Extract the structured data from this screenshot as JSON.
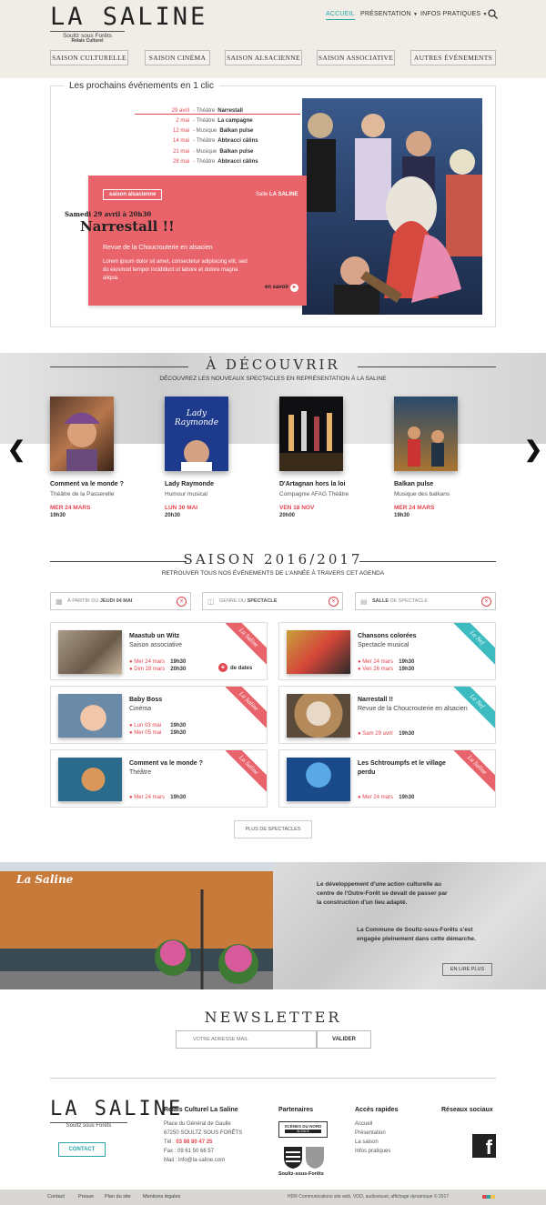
{
  "header": {
    "logo": "LA SALINE",
    "logo_sub": "Soultz sous Forêts",
    "logo_sub2": "Relais Culturel",
    "nav": [
      "ACCUEIL",
      "PRÉSENTATION",
      "INFOS PRATIQUES"
    ],
    "seasons": [
      "SAISON CULTURELLE",
      "SAISON CINÉMA",
      "SAISON ALSACIENNE",
      "SAISON ASSOCIATIVE",
      "AUTRES ÉVÉNEMENTS"
    ]
  },
  "featured": {
    "heading": "Les prochains événements en 1 clic",
    "events": [
      {
        "date": "29 avril",
        "cat": "Théâtre",
        "title": "Narrestall"
      },
      {
        "date": "2 mai",
        "cat": "Théâtre",
        "title": "La campagne"
      },
      {
        "date": "12 mai",
        "cat": "Musique",
        "title": "Balkan pulse"
      },
      {
        "date": "14 mai",
        "cat": "Théâtre",
        "title": "Abbracci câlins"
      },
      {
        "date": "21 mai",
        "cat": "Musique",
        "title": "Balkan pulse"
      },
      {
        "date": "28 mai",
        "cat": "Théâtre",
        "title": "Abbracci câlins"
      }
    ],
    "card": {
      "badge": "saison alsacienne",
      "salle_label": "Salle",
      "salle": "LA SALINE",
      "date": "Samedi 29 avril à 20h30",
      "title": "Narrestall !!",
      "subtitle": "Revue de la Choucrouterie en alsacien",
      "text": "Lorem ipsum dolor sit amet, consectetur adipisicing elit, sed do eiusmod tempor incididunt ut labore et dolore magna aliqua.",
      "more": "en savoir"
    }
  },
  "decouvrir": {
    "title": "À DÉCOUVRIR",
    "subtitle": "DÉCOUVREZ LES NOUVEAUX SPECTACLES EN REPRÉSENTATION À LA SALINE",
    "items": [
      {
        "title": "Comment va le monde ?",
        "sub": "Théâtre de la Passerelle",
        "date": "MER 24 MARS",
        "time": "19h30",
        "poster_text": ""
      },
      {
        "title": "Lady Raymonde",
        "sub": "Humour musical",
        "date": "LUN 30 MAI",
        "time": "20h30",
        "poster_text": "Lady Raymonde"
      },
      {
        "title": "D'Artagnan hors la loi",
        "sub": "Compagnie AFAG Théâtre",
        "date": "VEN 18 NOV",
        "time": "20h00",
        "poster_text": ""
      },
      {
        "title": "Balkan pulse",
        "sub": "Musique des balkans",
        "date": "MER 24 MARS",
        "time": "19h30",
        "poster_text": ""
      }
    ]
  },
  "saison": {
    "title": "SAISON 2016/2017",
    "subtitle": "RETROUVER TOUS NOS ÉVÉNEMENTS DE L'ANNÉE À TRAVERS CET AGENDA",
    "filters": [
      {
        "pre": "À PARTIR DU",
        "bold": "JEUDI 04 MAI",
        "post": ""
      },
      {
        "pre": "GENRE DU",
        "bold": "SPECTACLE",
        "post": ""
      },
      {
        "pre": "",
        "bold": "SALLE",
        "post": "DE SPECTACLE"
      }
    ],
    "events": [
      {
        "title": "Maastub un Witz",
        "title2": "",
        "sub": "Saison associative",
        "dates": [
          {
            "d": "Mer 24 mars",
            "t": "19h30"
          },
          {
            "d": "Dim 28 mars",
            "t": "20h30"
          }
        ],
        "more": "de dates",
        "ribbon": "La Saline"
      },
      {
        "title": "Chansons colorées",
        "title2": "",
        "sub": "Spectacle musical",
        "dates": [
          {
            "d": "Mer 24 mars",
            "t": "19h30"
          },
          {
            "d": "Ven 26 mars",
            "t": "19h30"
          }
        ],
        "more": "",
        "ribbon": "La Nef"
      },
      {
        "title": "Baby Boss",
        "title2": "",
        "sub": "Cinéma",
        "dates": [
          {
            "d": "Lun 03 mai",
            "t": "19h30"
          },
          {
            "d": "Mer 05 mai",
            "t": "19h30"
          }
        ],
        "more": "",
        "ribbon": "La Saline"
      },
      {
        "title": "Narrestall !!",
        "title2": "",
        "sub": "Revue de la Choucrouterie en alsacien",
        "dates": [
          {
            "d": "Sam 29 avril",
            "t": "19h30"
          }
        ],
        "more": "",
        "ribbon": "La Nef"
      },
      {
        "title": "Comment va le monde ?",
        "title2": "",
        "sub": "Théâtre",
        "dates": [
          {
            "d": "Mer 24 mars",
            "t": "19h30"
          }
        ],
        "more": "",
        "ribbon": "La Saline"
      },
      {
        "title": "Les Schtroumpfs et le village",
        "title2": "perdu",
        "sub": "",
        "dates": [
          {
            "d": "Mer 24 mars",
            "t": "19h30"
          }
        ],
        "more": "",
        "ribbon": "La Saline"
      }
    ],
    "more_button": "PLUS DE SPECTACLES"
  },
  "about": {
    "building_sign": "La Saline",
    "p1": "Le développement d'une action culturelle au centre de l'Outre-Forêt se devait de passer par la construction d'un lieu adapté.",
    "p2": "La Commune de Soultz-sous-Forêts s'est engagée pleinement dans cette démarche.",
    "button": "EN LIRE PLUS"
  },
  "newsletter": {
    "title": "NEWSLETTER",
    "placeholder": "VOTRE ADRESSE MAIL",
    "button": "VALIDER"
  },
  "footer": {
    "contact_button": "CONTACT",
    "col1_title": "Relais Culturel La Saline",
    "address": [
      "Place du Général de Gaulle",
      "67250 SOULTZ SOUS FORÊTS",
      "Tél :",
      "Fax : 09 61 50 66 57",
      "Mail : info@la-saline.com"
    ],
    "phone": "03 88 80 47 25",
    "col2_title": "Partenaires",
    "partner1": "SCÈNES DU NORD",
    "partner1_sub": "ALSACE",
    "partner2": "Soultz-sous-Forêts",
    "col3_title": "Accès rapides",
    "links": [
      "Accueil",
      "Présentation",
      "La saison",
      "Infos pratiques"
    ],
    "col4_title": "Réseaux sociaux",
    "bottom_links": [
      "Contact",
      "Presse",
      "Plan du site",
      "Mentions légales"
    ],
    "credit": "HDR Communications site web, VOD, audiovisuel, affichage dynamique © 2017"
  }
}
